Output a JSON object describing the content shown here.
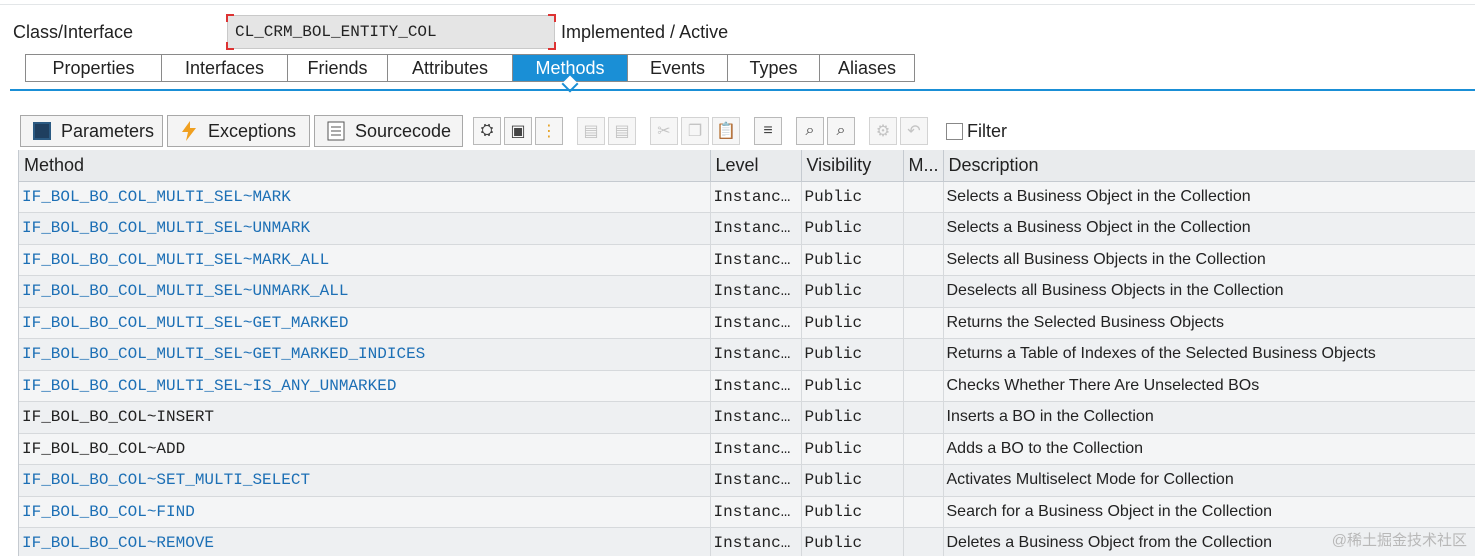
{
  "header": {
    "class_label": "Class/Interface",
    "class_value": "CL_CRM_BOL_ENTITY_COL",
    "status": "Implemented / Active"
  },
  "tabs": [
    {
      "label": "Properties",
      "active": false
    },
    {
      "label": "Interfaces",
      "active": false
    },
    {
      "label": "Friends",
      "active": false
    },
    {
      "label": "Attributes",
      "active": false
    },
    {
      "label": "Methods",
      "active": true
    },
    {
      "label": "Events",
      "active": false
    },
    {
      "label": "Types",
      "active": false
    },
    {
      "label": "Aliases",
      "active": false
    }
  ],
  "toolbar": {
    "parameters_label": "Parameters",
    "exceptions_label": "Exceptions",
    "sourcecode_label": "Sourcecode",
    "filter_label": "Filter",
    "icons": [
      "detail-view-icon",
      "copy-window-icon",
      "hierarchy-icon",
      "insert-row-icon",
      "delete-row-icon",
      "cut-icon",
      "copy-icon",
      "paste-icon",
      "sort-icon",
      "find-icon",
      "find-next-icon",
      "settings-icon",
      "undo-icon"
    ]
  },
  "grid": {
    "columns": [
      "Method",
      "Level",
      "Visibility",
      "M...",
      "Description"
    ],
    "rows": [
      {
        "method": "IF_BOL_BO_COL_MULTI_SEL~MARK",
        "level": "Instanc…",
        "visibility": "Public",
        "m": "",
        "description": "Selects a Business Object in the Collection",
        "link": true
      },
      {
        "method": "IF_BOL_BO_COL_MULTI_SEL~UNMARK",
        "level": "Instanc…",
        "visibility": "Public",
        "m": "",
        "description": "Selects a Business Object in the Collection",
        "link": true
      },
      {
        "method": "IF_BOL_BO_COL_MULTI_SEL~MARK_ALL",
        "level": "Instanc…",
        "visibility": "Public",
        "m": "",
        "description": "Selects all Business Objects in the Collection",
        "link": true
      },
      {
        "method": "IF_BOL_BO_COL_MULTI_SEL~UNMARK_ALL",
        "level": "Instanc…",
        "visibility": "Public",
        "m": "",
        "description": "Deselects all Business Objects in the Collection",
        "link": true
      },
      {
        "method": "IF_BOL_BO_COL_MULTI_SEL~GET_MARKED",
        "level": "Instanc…",
        "visibility": "Public",
        "m": "",
        "description": "Returns the Selected Business Objects",
        "link": true
      },
      {
        "method": "IF_BOL_BO_COL_MULTI_SEL~GET_MARKED_INDICES",
        "level": "Instanc…",
        "visibility": "Public",
        "m": "",
        "description": "Returns a Table of Indexes of the Selected Business Objects",
        "link": true
      },
      {
        "method": "IF_BOL_BO_COL_MULTI_SEL~IS_ANY_UNMARKED",
        "level": "Instanc…",
        "visibility": "Public",
        "m": "",
        "description": "Checks Whether There Are Unselected BOs",
        "link": true
      },
      {
        "method": "IF_BOL_BO_COL~INSERT",
        "level": "Instanc…",
        "visibility": "Public",
        "m": "",
        "description": "Inserts a BO in the Collection",
        "link": false
      },
      {
        "method": "IF_BOL_BO_COL~ADD",
        "level": "Instanc…",
        "visibility": "Public",
        "m": "",
        "description": "Adds a BO to the Collection",
        "link": false
      },
      {
        "method": "IF_BOL_BO_COL~SET_MULTI_SELECT",
        "level": "Instanc…",
        "visibility": "Public",
        "m": "",
        "description": "Activates Multiselect Mode for Collection",
        "link": true
      },
      {
        "method": "IF_BOL_BO_COL~FIND",
        "level": "Instanc…",
        "visibility": "Public",
        "m": "",
        "description": "Search for a Business Object in the Collection",
        "link": true
      },
      {
        "method": "IF_BOL_BO_COL~REMOVE",
        "level": "Instanc…",
        "visibility": "Public",
        "m": "",
        "description": "Deletes a Business Object from the Collection",
        "link": true
      }
    ]
  },
  "watermark": "@稀土掘金技术社区",
  "colors": {
    "accent": "#1a8fd6",
    "link": "#1c6fb5"
  }
}
